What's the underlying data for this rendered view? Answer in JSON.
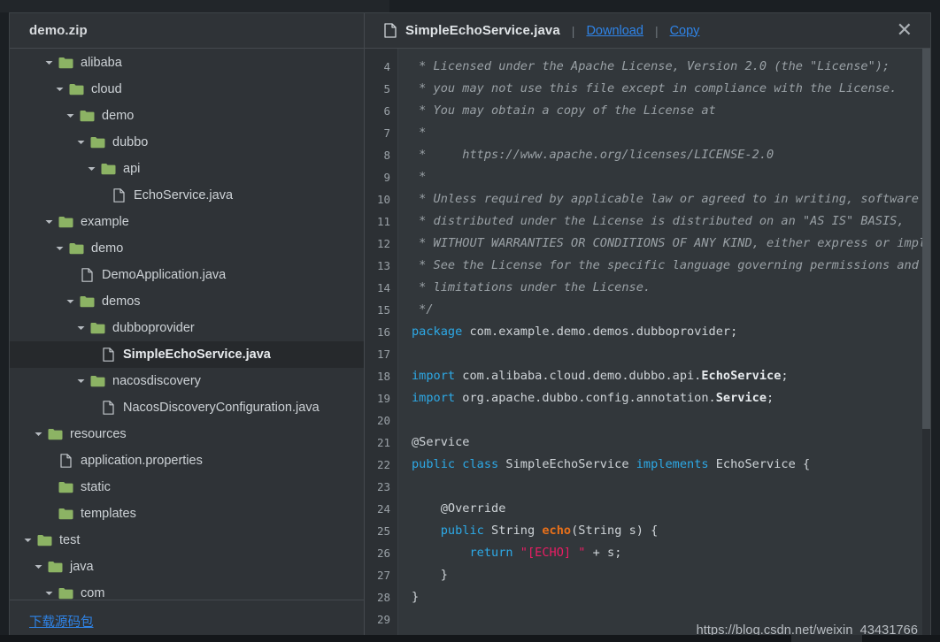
{
  "left_panel": {
    "archive_title": "demo.zip",
    "download_source_label": "下载源码包",
    "tree": [
      {
        "label": "alibaba",
        "type": "folder",
        "depth": 2,
        "expanded": true,
        "selected": false
      },
      {
        "label": "cloud",
        "type": "folder",
        "depth": 3,
        "expanded": true,
        "selected": false
      },
      {
        "label": "demo",
        "type": "folder",
        "depth": 4,
        "expanded": true,
        "selected": false
      },
      {
        "label": "dubbo",
        "type": "folder",
        "depth": 5,
        "expanded": true,
        "selected": false
      },
      {
        "label": "api",
        "type": "folder",
        "depth": 6,
        "expanded": true,
        "selected": false
      },
      {
        "label": "EchoService.java",
        "type": "file",
        "depth": 7,
        "expanded": false,
        "selected": false
      },
      {
        "label": "example",
        "type": "folder",
        "depth": 2,
        "expanded": true,
        "selected": false
      },
      {
        "label": "demo",
        "type": "folder",
        "depth": 3,
        "expanded": true,
        "selected": false
      },
      {
        "label": "DemoApplication.java",
        "type": "file",
        "depth": 4,
        "expanded": false,
        "selected": false
      },
      {
        "label": "demos",
        "type": "folder",
        "depth": 4,
        "expanded": true,
        "selected": false
      },
      {
        "label": "dubboprovider",
        "type": "folder",
        "depth": 5,
        "expanded": true,
        "selected": false
      },
      {
        "label": "SimpleEchoService.java",
        "type": "file",
        "depth": 6,
        "expanded": false,
        "selected": true
      },
      {
        "label": "nacosdiscovery",
        "type": "folder",
        "depth": 5,
        "expanded": true,
        "selected": false
      },
      {
        "label": "NacosDiscoveryConfiguration.java",
        "type": "file",
        "depth": 6,
        "expanded": false,
        "selected": false
      },
      {
        "label": "resources",
        "type": "folder",
        "depth": 1,
        "expanded": true,
        "selected": false
      },
      {
        "label": "application.properties",
        "type": "file",
        "depth": 2,
        "expanded": false,
        "selected": false
      },
      {
        "label": "static",
        "type": "folder",
        "depth": 2,
        "expanded": null,
        "selected": false
      },
      {
        "label": "templates",
        "type": "folder",
        "depth": 2,
        "expanded": null,
        "selected": false
      },
      {
        "label": "test",
        "type": "folder",
        "depth": 0,
        "expanded": true,
        "selected": false
      },
      {
        "label": "java",
        "type": "folder",
        "depth": 1,
        "expanded": true,
        "selected": false
      },
      {
        "label": "com",
        "type": "folder",
        "depth": 2,
        "expanded": true,
        "selected": false
      }
    ]
  },
  "right_panel": {
    "file_icon": "file-icon",
    "file_name": "SimpleEchoService.java",
    "separator": "|",
    "download_label": "Download",
    "copy_label": "Copy",
    "close_icon": "✕",
    "watermark": "https://blog.csdn.net/weixin_43431766",
    "code": [
      {
        "num": "4",
        "tokens": [
          {
            "t": "com",
            "v": " * Licensed under the Apache License, Version 2.0 (the \"License\");"
          }
        ]
      },
      {
        "num": "5",
        "tokens": [
          {
            "t": "com",
            "v": " * you may not use this file except in compliance with the License."
          }
        ]
      },
      {
        "num": "6",
        "tokens": [
          {
            "t": "com",
            "v": " * You may obtain a copy of the License at"
          }
        ]
      },
      {
        "num": "7",
        "tokens": [
          {
            "t": "com",
            "v": " *"
          }
        ]
      },
      {
        "num": "8",
        "tokens": [
          {
            "t": "com",
            "v": " *     https://www.apache.org/licenses/LICENSE-2.0"
          }
        ]
      },
      {
        "num": "9",
        "tokens": [
          {
            "t": "com",
            "v": " *"
          }
        ]
      },
      {
        "num": "10",
        "tokens": [
          {
            "t": "com",
            "v": " * Unless required by applicable law or agreed to in writing, software"
          }
        ]
      },
      {
        "num": "11",
        "tokens": [
          {
            "t": "com",
            "v": " * distributed under the License is distributed on an \"AS IS\" BASIS,"
          }
        ]
      },
      {
        "num": "12",
        "tokens": [
          {
            "t": "com",
            "v": " * WITHOUT WARRANTIES OR CONDITIONS OF ANY KIND, either express or implied."
          }
        ]
      },
      {
        "num": "13",
        "tokens": [
          {
            "t": "com",
            "v": " * See the License for the specific language governing permissions and"
          }
        ]
      },
      {
        "num": "14",
        "tokens": [
          {
            "t": "com",
            "v": " * limitations under the License."
          }
        ]
      },
      {
        "num": "15",
        "tokens": [
          {
            "t": "com",
            "v": " */"
          }
        ]
      },
      {
        "num": "16",
        "tokens": [
          {
            "t": "kw",
            "v": "package"
          },
          {
            "t": "pln",
            "v": " com.example.demo.demos.dubboprovider;"
          }
        ]
      },
      {
        "num": "17",
        "tokens": [
          {
            "t": "pln",
            "v": ""
          }
        ]
      },
      {
        "num": "18",
        "tokens": [
          {
            "t": "kw",
            "v": "import"
          },
          {
            "t": "pln",
            "v": " com.alibaba.cloud.demo.dubbo.api."
          },
          {
            "t": "typ",
            "v": "EchoService"
          },
          {
            "t": "pln",
            "v": ";"
          }
        ]
      },
      {
        "num": "19",
        "tokens": [
          {
            "t": "kw",
            "v": "import"
          },
          {
            "t": "pln",
            "v": " org.apache.dubbo.config.annotation."
          },
          {
            "t": "typ",
            "v": "Service"
          },
          {
            "t": "pln",
            "v": ";"
          }
        ]
      },
      {
        "num": "20",
        "tokens": [
          {
            "t": "pln",
            "v": ""
          }
        ]
      },
      {
        "num": "21",
        "tokens": [
          {
            "t": "ann",
            "v": "@Service"
          }
        ]
      },
      {
        "num": "22",
        "tokens": [
          {
            "t": "kw",
            "v": "public class"
          },
          {
            "t": "pln",
            "v": " SimpleEchoService "
          },
          {
            "t": "kw",
            "v": "implements"
          },
          {
            "t": "pln",
            "v": " EchoService {"
          }
        ]
      },
      {
        "num": "23",
        "tokens": [
          {
            "t": "pln",
            "v": ""
          }
        ]
      },
      {
        "num": "24",
        "tokens": [
          {
            "t": "ann",
            "v": "    @Override"
          }
        ]
      },
      {
        "num": "25",
        "tokens": [
          {
            "t": "pln",
            "v": "    "
          },
          {
            "t": "kw",
            "v": "public"
          },
          {
            "t": "pln",
            "v": " String "
          },
          {
            "t": "fn",
            "v": "echo"
          },
          {
            "t": "pln",
            "v": "(String s) {"
          }
        ]
      },
      {
        "num": "26",
        "tokens": [
          {
            "t": "pln",
            "v": "        "
          },
          {
            "t": "kw",
            "v": "return"
          },
          {
            "t": "pln",
            "v": " "
          },
          {
            "t": "str",
            "v": "\"[ECHO] \""
          },
          {
            "t": "pln",
            "v": " + s;"
          }
        ]
      },
      {
        "num": "27",
        "tokens": [
          {
            "t": "pln",
            "v": "    }"
          }
        ]
      },
      {
        "num": "28",
        "tokens": [
          {
            "t": "pln",
            "v": "}"
          }
        ]
      },
      {
        "num": "29",
        "tokens": [
          {
            "t": "pln",
            "v": ""
          }
        ]
      }
    ]
  },
  "colors": {
    "panel_bg": "#2f3337",
    "code_bg": "#32373b",
    "gutter_bg": "#2c3034",
    "link_blue": "#2f84e8",
    "keyword_blue": "#2da9e6",
    "string_pink": "#ea1d63",
    "method_orange": "#e8701a",
    "folder_green": "#8cb364",
    "selected_row": "#26292c"
  }
}
